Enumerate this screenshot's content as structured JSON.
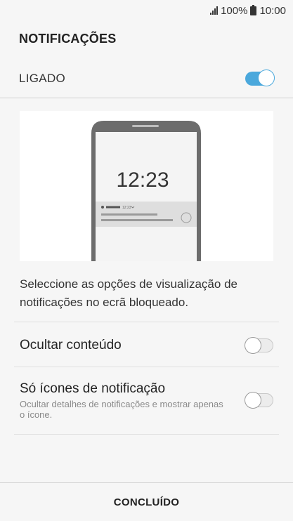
{
  "status_bar": {
    "battery": "100%",
    "time": "10:00",
    "icons": [
      "signal-icon",
      "battery-icon"
    ]
  },
  "header": {
    "title": "NOTIFICAÇÕES"
  },
  "master_switch": {
    "label": "LIGADO",
    "state": "on"
  },
  "preview": {
    "clock": "12:23",
    "notification_time": "12:23"
  },
  "description": "Seleccione as opções de visualização de notificações no ecrã bloqueado.",
  "options": [
    {
      "label": "Ocultar conteúdo",
      "state": "off"
    },
    {
      "label": "Só ícones de notificação",
      "sublabel": "Ocultar detalhes de notificações e mostrar apenas o ícone.",
      "state": "off"
    }
  ],
  "footer": {
    "done_label": "CONCLUÍDO"
  },
  "colors": {
    "accent": "#4aa8dc",
    "background": "#f6f6f6"
  }
}
